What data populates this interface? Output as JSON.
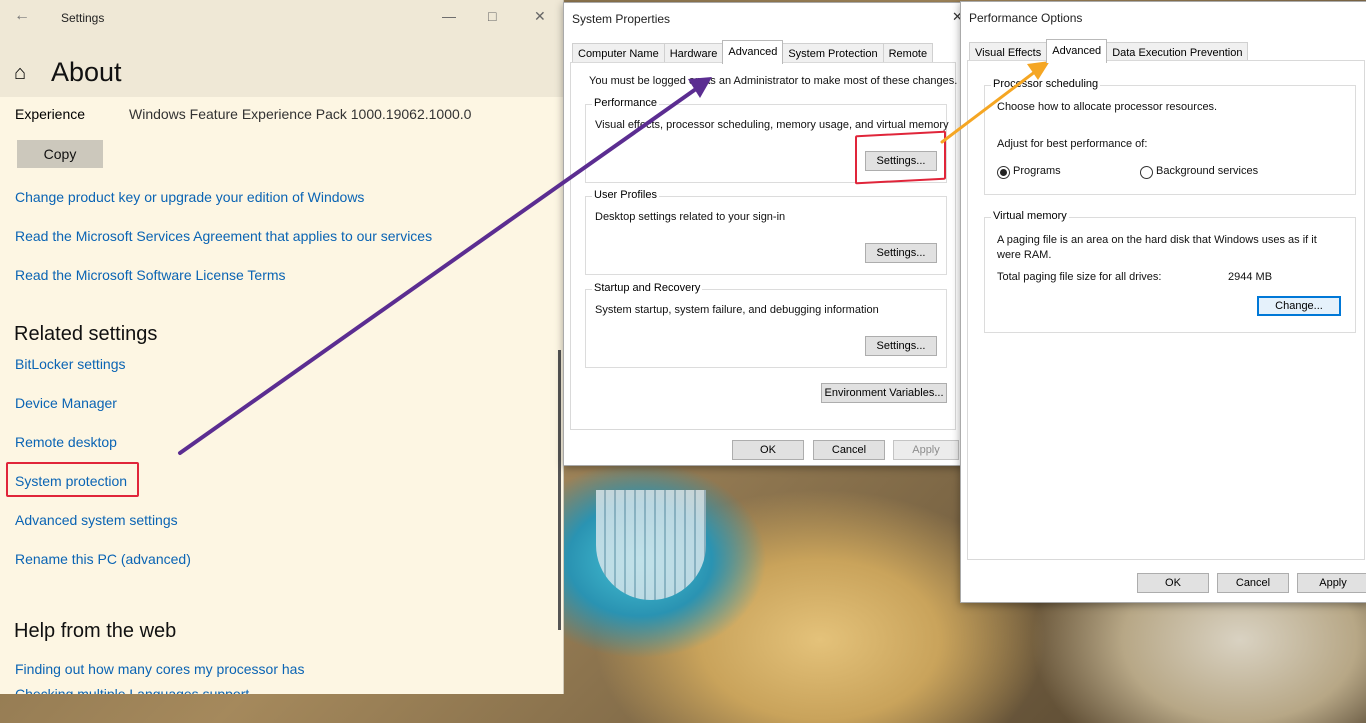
{
  "settings": {
    "title": "Settings",
    "page_title": "About",
    "experience_label": "Experience",
    "experience_value": "Windows Feature Experience Pack 1000.19062.1000.0",
    "copy_label": "Copy",
    "links": [
      "Change product key or upgrade your edition of Windows",
      "Read the Microsoft Services Agreement that applies to our services",
      "Read the Microsoft Software License Terms"
    ],
    "related_heading": "Related settings",
    "related": [
      "BitLocker settings",
      "Device Manager",
      "Remote desktop",
      "System protection",
      "Advanced system settings",
      "Rename this PC (advanced)"
    ],
    "help_heading": "Help from the web",
    "help_links": [
      "Finding out how many cores my processor has",
      "Checking multiple Languages support"
    ]
  },
  "system_properties": {
    "title": "System Properties",
    "tabs": [
      "Computer Name",
      "Hardware",
      "Advanced",
      "System Protection",
      "Remote"
    ],
    "admin_note": "You must be logged on as an Administrator to make most of these changes.",
    "performance": {
      "label": "Performance",
      "desc": "Visual effects, processor scheduling, memory usage, and virtual memory",
      "button": "Settings..."
    },
    "user_profiles": {
      "label": "User Profiles",
      "desc": "Desktop settings related to your sign-in",
      "button": "Settings..."
    },
    "startup": {
      "label": "Startup and Recovery",
      "desc": "System startup, system failure, and debugging information",
      "button": "Settings..."
    },
    "env_button": "Environment Variables...",
    "ok": "OK",
    "cancel": "Cancel",
    "apply": "Apply"
  },
  "performance_options": {
    "title": "Performance Options",
    "tabs": [
      "Visual Effects",
      "Advanced",
      "Data Execution Prevention"
    ],
    "scheduling": {
      "label": "Processor scheduling",
      "desc": "Choose how to allocate processor resources.",
      "adjust": "Adjust for best performance of:",
      "option_programs": "Programs",
      "option_background": "Background services",
      "selected": "Programs"
    },
    "virtual_memory": {
      "label": "Virtual memory",
      "desc_line1": "A paging file is an area on the hard disk that Windows uses as if it",
      "desc_line2": "were RAM.",
      "total_label": "Total paging file size for all drives:",
      "total_value": "2944 MB",
      "change_button": "Change..."
    },
    "ok": "OK",
    "cancel": "Cancel",
    "apply": "Apply"
  },
  "colors": {
    "link": "#0a64b4",
    "highlight_box": "#e0253a",
    "arrow_purple": "#5b2d91",
    "arrow_orange": "#f5a623"
  }
}
